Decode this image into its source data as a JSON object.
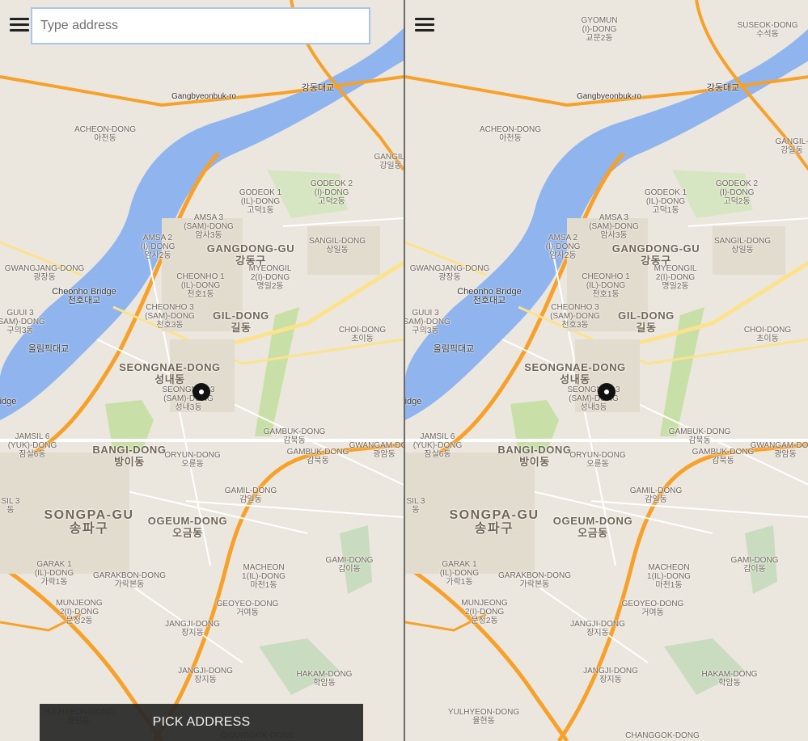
{
  "search": {
    "placeholder": "Type address"
  },
  "pick_button": {
    "label": "PICK ADDRESS"
  },
  "icons": {
    "menu": "menu-icon",
    "pin": "location-pin-icon"
  },
  "colors": {
    "water": "#8fb4ee",
    "highway": "#f7a12a",
    "arterial": "#fce28b",
    "park": "#c8e0a8",
    "land": "#ebe7df"
  },
  "labels": {
    "gangbyeon": "Gangbyeonbuk-ro",
    "gangdong_bridge": "강동대교",
    "acheon": "ACHEON-DONG\n아천동",
    "godeok1": "GODEOK 1\n(IL)-DONG\n고덕1동",
    "godeok2": "GODEOK 2\n(I)-DONG\n고덕2동",
    "amsa3": "AMSA 3\n(SAM)-DONG\n암사3동",
    "amsa2": "AMSA 2\n(I)-DONG\n암사2동",
    "gangdong_gu": "GANGDONG-GU\n강동구",
    "sangil": "SANGIL-DONG\n상일동",
    "myeongil2": "MYEONGIL\n2(I)-DONG\n명일2동",
    "cheonho1": "CHEONHO 1\n(IL)-DONG\n천호1동",
    "cheonho3": "CHEONHO 3\n(SAM)-DONG\n천호3동",
    "gil": "GIL-DONG\n길동",
    "gwangjang": "GWANGJANG-DONG\n광장동",
    "cheonho_bridge": "Cheonho Bridge\n천호대교",
    "olympic_bridge": "올림픽대교",
    "guui3": "GUUI 3\n(SAM)-DONG\n구의3동",
    "choi": "CHOI-DONG\n초이동",
    "seongnae": "SEONGNAE-DONG\n성내동",
    "seongnae3": "SEONGNAE 3\n(SAM)-DONG\n성내3동",
    "gambuk": "GAMBUK-DONG\n감북동",
    "gwangam": "GWANGAM-DONG\n광암동",
    "jamsil6": "JAMSIL 6\n(YUK)-DONG\n잠실6동",
    "bangi": "BANGI-DONG\n방이동",
    "oryun": "ORYUN-DONG\n오륜동",
    "gamil": "GAMIL-DONG\n감일동",
    "songpa_gu": "SONGPA-GU\n송파구",
    "ogeum": "OGEUM-DONG\n오금동",
    "gami": "GAMI-DONG\n감이동",
    "garak1": "GARAK 1\n(IL)-DONG\n가락1동",
    "garakbon": "GARAKBON-DONG\n가락본동",
    "macheon1": "MACHEON\n1(IL)-DONG\n마천1동",
    "munjeong2": "MUNJEONG\n2(I)-DONG\n문정2동",
    "geoyeo": "GEOYEO-DONG\n거여동",
    "jangji": "JANGJI-DONG\n장지동",
    "hakam": "HAKAM-DONG\n학암동",
    "jangjiu": "JANGJI-DONG\n장지동",
    "yulhyeon": "YULHYEON-DONG\n율현동",
    "changgok": "CHANGGOK-DONG",
    "suseok": "SUSEOK-DONG\n수석동",
    "gyomun2": "GYOMUN\n(I)-DONG\n교문2동",
    "gangil": "GANGIL-\n강일동",
    "jamsil3": "SIL 3\n동",
    "bridge_partial": "idge",
    "jangjidong2": "JANGJI-DONG\n장지동"
  }
}
